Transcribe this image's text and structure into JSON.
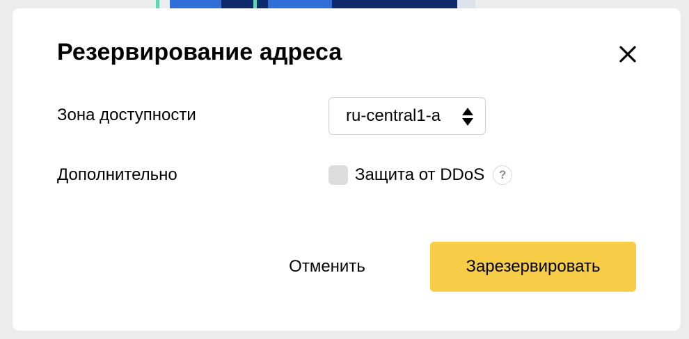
{
  "modal": {
    "title": "Резервирование адреса",
    "close_icon": "close-icon"
  },
  "form": {
    "zone": {
      "label": "Зона доступности",
      "value": "ru-central1-a",
      "icon": "select-arrows-icon"
    },
    "extra": {
      "label": "Дополнительно",
      "ddos_label": "Защита от DDoS",
      "ddos_checked": false,
      "help_icon": "question-icon",
      "help_glyph": "?"
    }
  },
  "actions": {
    "cancel_label": "Отменить",
    "submit_label": "Зарезервировать"
  },
  "colors": {
    "backdrop": "#ececec",
    "primary": "#f7cc46",
    "checkbox": "#dcdcdc",
    "bg_blue": "#2f6fd6",
    "bg_navy": "#0d2a6b",
    "bg_teal": "#5fd6b4"
  }
}
